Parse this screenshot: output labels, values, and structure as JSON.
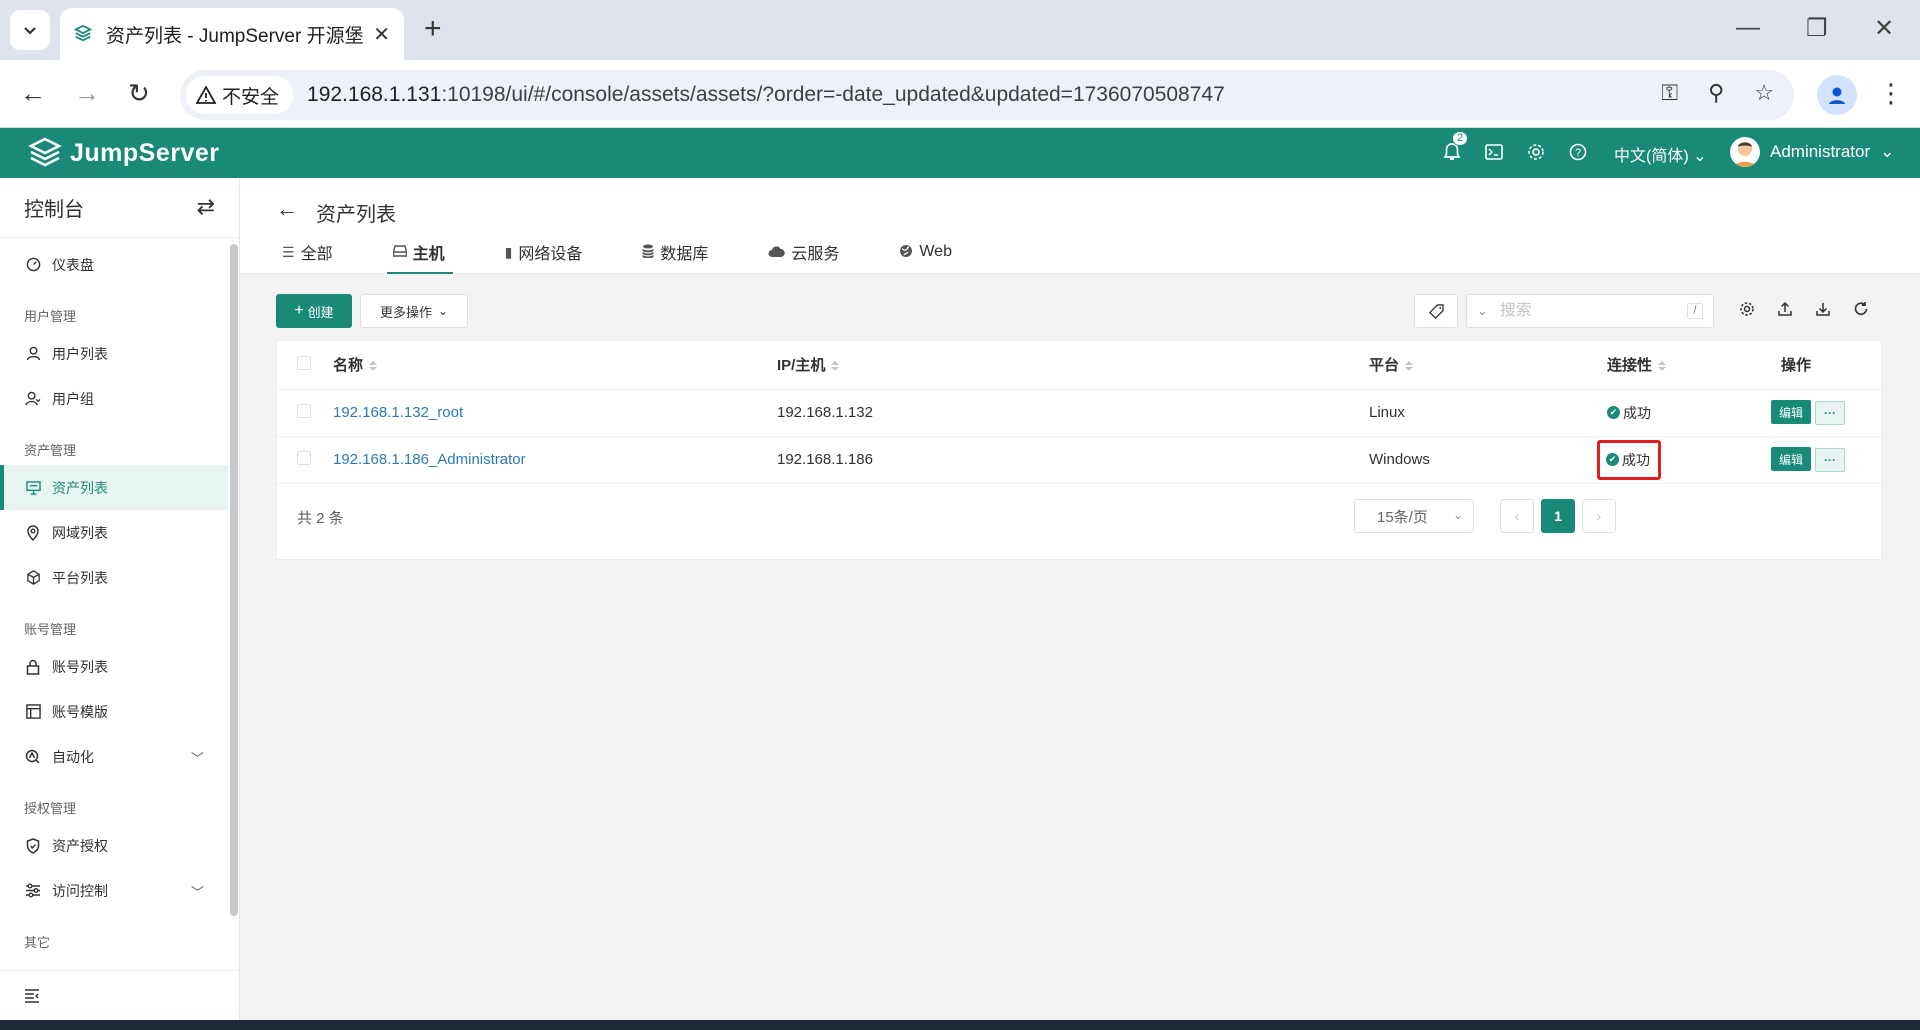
{
  "browser": {
    "tab_title": "资产列表 - JumpServer 开源堡",
    "url_host": "192.168.1.131",
    "url_rest": ":10198/ui/#/console/assets/assets/?order=-date_updated&updated=1736070508747",
    "security_label": "不安全"
  },
  "header": {
    "brand": "JumpServer",
    "notification_count": "2",
    "language": "中文(简体)",
    "user": "Administrator"
  },
  "sidebar": {
    "title": "控制台",
    "groups": {
      "user_mgmt": "用户管理",
      "asset_mgmt": "资产管理",
      "account_mgmt": "账号管理",
      "perm_mgmt": "授权管理",
      "other": "其它"
    },
    "items": {
      "dashboard": "仪表盘",
      "user_list": "用户列表",
      "user_group": "用户组",
      "asset_list": "资产列表",
      "zone_list": "网域列表",
      "platform_list": "平台列表",
      "account_list": "账号列表",
      "account_template": "账号模版",
      "automation": "自动化",
      "asset_perm": "资产授权",
      "access_control": "访问控制"
    }
  },
  "page": {
    "title": "资产列表",
    "tabs": [
      "全部",
      "主机",
      "网络设备",
      "数据库",
      "云服务",
      "Web"
    ],
    "active_tab": "主机"
  },
  "toolbar": {
    "create_label": "创建",
    "more_label": "更多操作",
    "search_placeholder": "搜索",
    "search_shortcut": "/"
  },
  "table": {
    "headers": {
      "name": "名称",
      "ip": "IP/主机",
      "platform": "平台",
      "connectivity": "连接性",
      "actions": "操作"
    },
    "rows": [
      {
        "name": "192.168.1.132_root",
        "ip": "192.168.1.132",
        "platform": "Linux",
        "connectivity": "成功",
        "edit": "编辑",
        "more": "···"
      },
      {
        "name": "192.168.1.186_Administrator",
        "ip": "192.168.1.186",
        "platform": "Windows",
        "connectivity": "成功",
        "edit": "编辑",
        "more": "···"
      }
    ]
  },
  "pagination": {
    "total": "共 2 条",
    "page_size": "15条/页",
    "current_page": "1"
  },
  "colors": {
    "accent": "#1a8a78",
    "link": "#2a7ab8",
    "highlight": "#e02020"
  }
}
